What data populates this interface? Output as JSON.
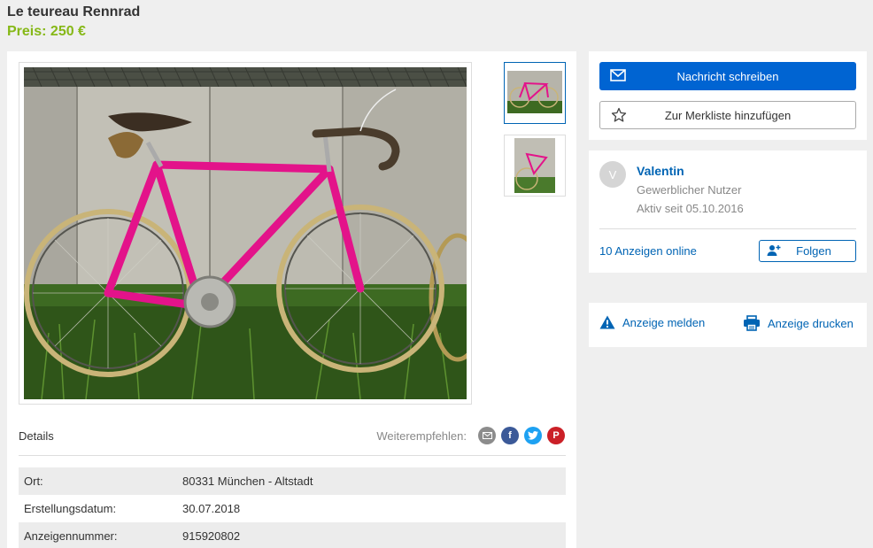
{
  "listing": {
    "title": "Le teureau Rennrad",
    "price": "Preis: 250 €"
  },
  "gallery": {
    "main_image": "pink-road-bike-photo",
    "thumbnails": [
      "pink-road-bike-thumb-1",
      "pink-road-bike-thumb-2"
    ]
  },
  "details": {
    "heading": "Details",
    "share_label": "Weiterempfehlen:",
    "share_icons": [
      "email-icon",
      "facebook-icon",
      "twitter-icon",
      "pinterest-icon"
    ],
    "rows": [
      {
        "key": "Ort:",
        "value": "80331 München - Altstadt"
      },
      {
        "key": "Erstellungsdatum:",
        "value": "30.07.2018"
      },
      {
        "key": "Anzeigennummer:",
        "value": "915920802"
      }
    ]
  },
  "actions": {
    "message_label": "Nachricht schreiben",
    "watchlist_label": "Zur Merkliste hinzufügen"
  },
  "seller": {
    "initial": "V",
    "name": "Valentin",
    "type": "Gewerblicher Nutzer",
    "active_since": "Aktiv seit 05.10.2016",
    "ads_online": "10 Anzeigen online",
    "follow_label": "Folgen"
  },
  "report": {
    "report_label": "Anzeige melden",
    "print_label": "Anzeige drucken"
  },
  "colors": {
    "primary": "#0064d2",
    "link": "#0064b4",
    "price": "#86b817",
    "email_share": "#8c8c8c",
    "facebook": "#3b5998",
    "twitter": "#1da1f2",
    "pinterest": "#cb2027"
  }
}
